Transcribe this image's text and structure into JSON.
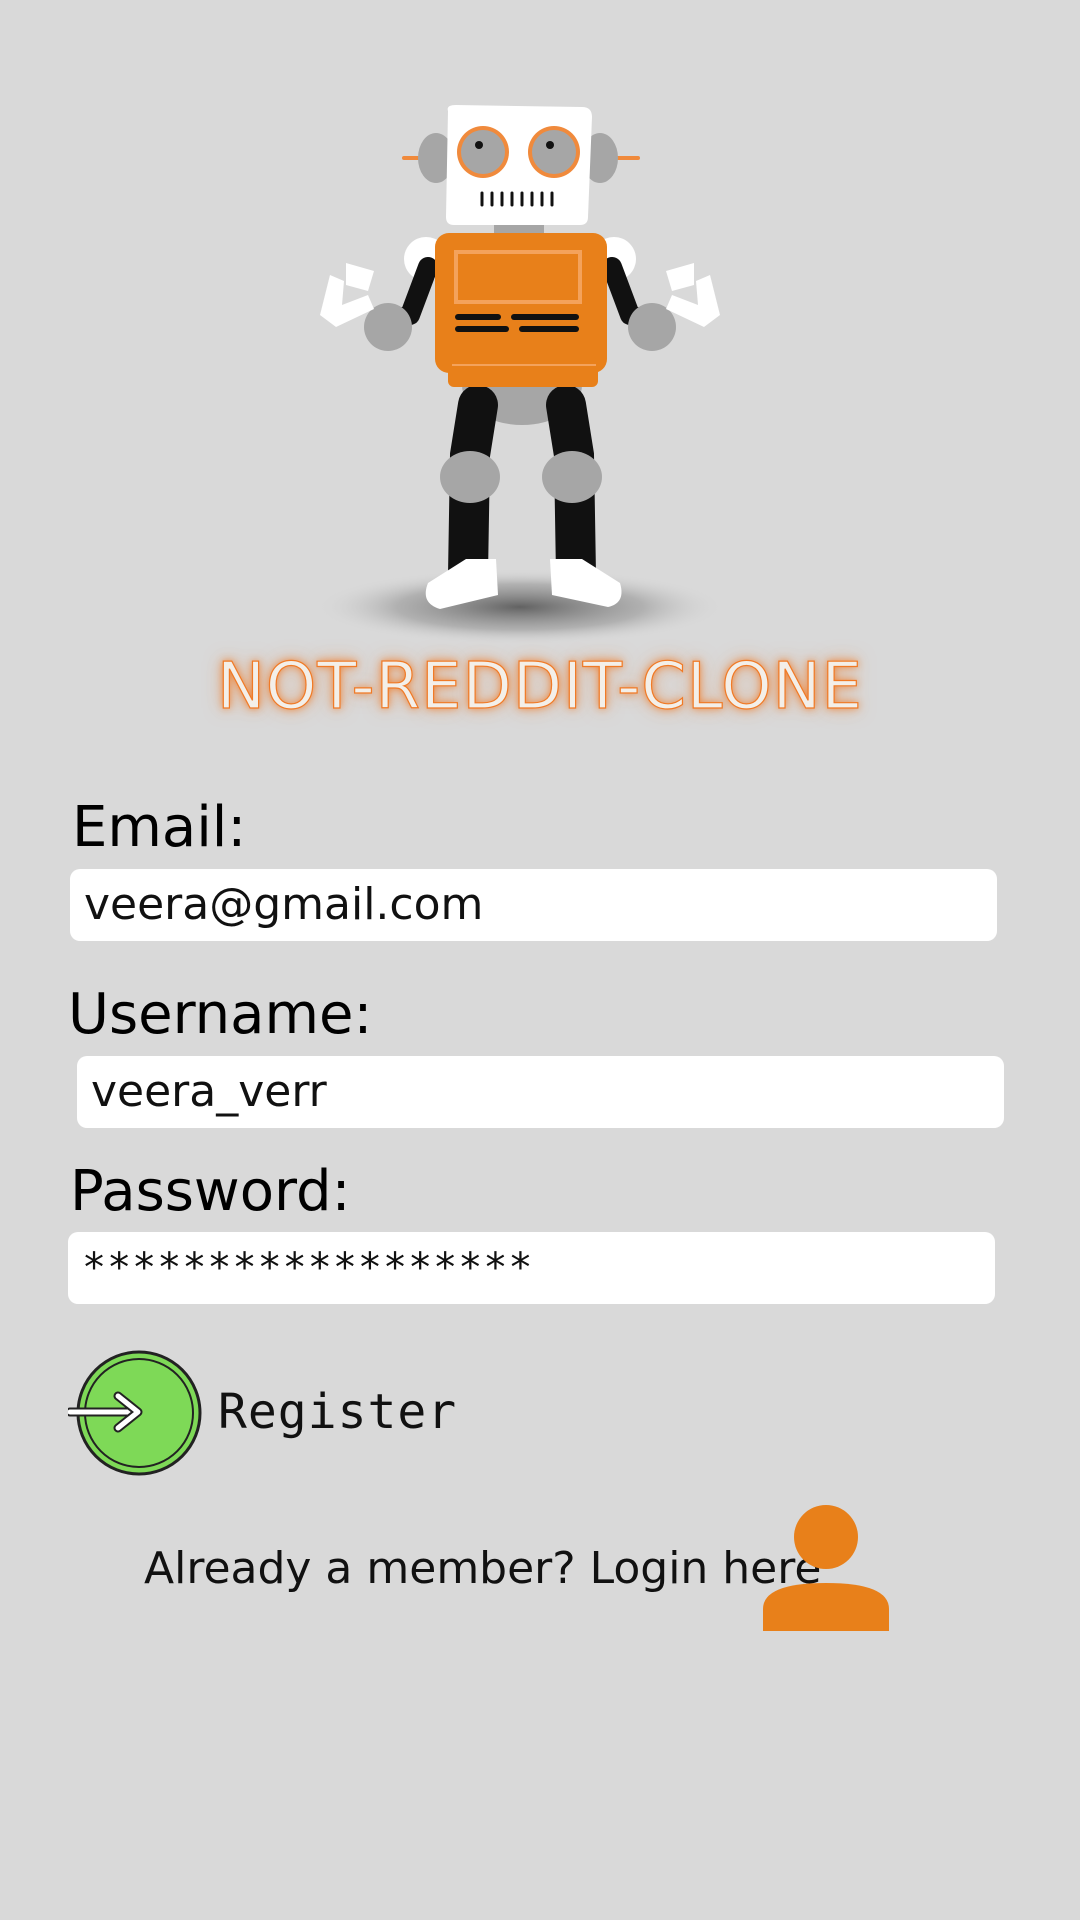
{
  "app": {
    "title": "NOT-REDDIT-CLONE"
  },
  "form": {
    "email": {
      "label": "Email:",
      "value": "veera@gmail.com"
    },
    "username": {
      "label": "Username:",
      "value": "veera_verr"
    },
    "password": {
      "label": "Password:",
      "value": "******************"
    },
    "register_label": "Register"
  },
  "footer": {
    "login_text": "Already a member? Login here"
  },
  "icons": {
    "robot": "robot-mascot-illustration",
    "register": "arrow-right-circle-icon",
    "login": "user-icon"
  },
  "colors": {
    "background": "#d9d9d9",
    "accent_orange": "#e8801a",
    "register_green": "#7ed957",
    "input_background": "#ffffff"
  }
}
